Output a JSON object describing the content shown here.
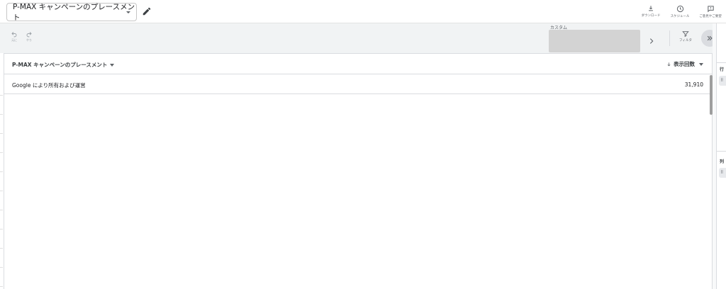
{
  "header": {
    "report_title": "P-MAX キャンペーンのプレースメント",
    "tools": [
      {
        "label": "ダウンロード",
        "icon": "download-icon"
      },
      {
        "label": "スケジュール",
        "icon": "schedule-icon"
      },
      {
        "label": "ご意見やご要望",
        "icon": "feedback-icon"
      }
    ]
  },
  "toolbar": {
    "undo_label": "元に",
    "redo_label": "やり",
    "custom_label": "カスタム",
    "filter_label": "フィルタ"
  },
  "table": {
    "dimension_header": "P-MAX キャンペーンのプレースメント",
    "metric_header": "表示回数",
    "rows": [
      {
        "dimension": "Google により所有および運営",
        "metric": "31,910"
      }
    ]
  },
  "side_panel": {
    "rows_label": "行",
    "columns_label": "列"
  },
  "colors": {
    "toolbar_bg": "#f1f3f4",
    "placeholder_box": "#d3d3d3",
    "border": "#dadce0",
    "icon": "#5f6368"
  }
}
